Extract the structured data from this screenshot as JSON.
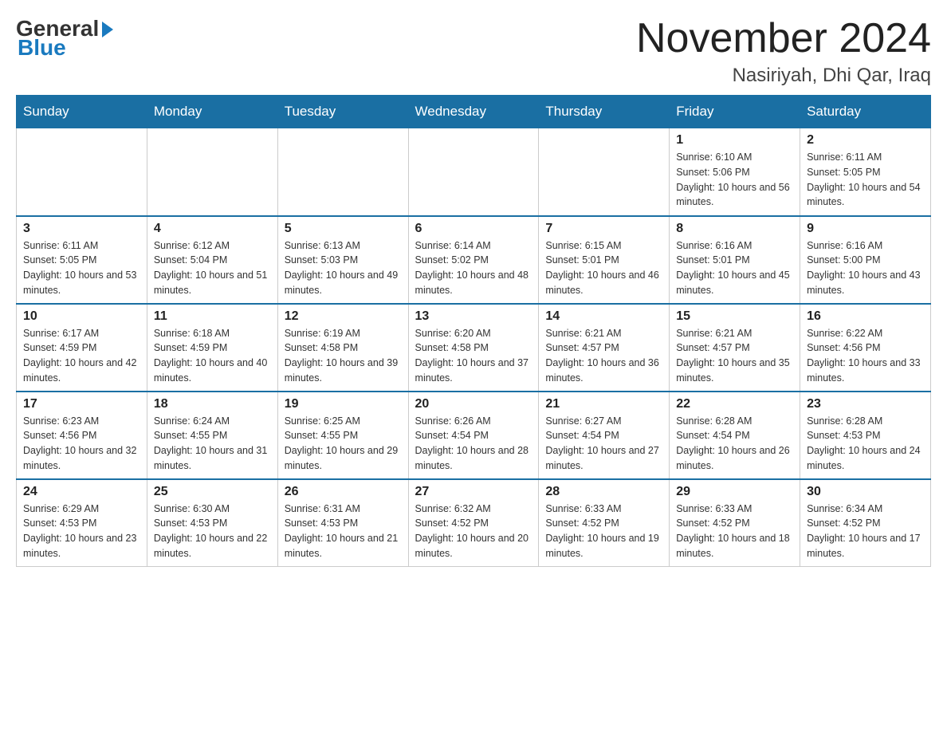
{
  "header": {
    "logo_general": "General",
    "logo_blue": "Blue",
    "month_title": "November 2024",
    "location": "Nasiriyah, Dhi Qar, Iraq"
  },
  "weekdays": [
    "Sunday",
    "Monday",
    "Tuesday",
    "Wednesday",
    "Thursday",
    "Friday",
    "Saturday"
  ],
  "weeks": [
    {
      "days": [
        {
          "number": "",
          "info": ""
        },
        {
          "number": "",
          "info": ""
        },
        {
          "number": "",
          "info": ""
        },
        {
          "number": "",
          "info": ""
        },
        {
          "number": "",
          "info": ""
        },
        {
          "number": "1",
          "info": "Sunrise: 6:10 AM\nSunset: 5:06 PM\nDaylight: 10 hours and 56 minutes."
        },
        {
          "number": "2",
          "info": "Sunrise: 6:11 AM\nSunset: 5:05 PM\nDaylight: 10 hours and 54 minutes."
        }
      ]
    },
    {
      "days": [
        {
          "number": "3",
          "info": "Sunrise: 6:11 AM\nSunset: 5:05 PM\nDaylight: 10 hours and 53 minutes."
        },
        {
          "number": "4",
          "info": "Sunrise: 6:12 AM\nSunset: 5:04 PM\nDaylight: 10 hours and 51 minutes."
        },
        {
          "number": "5",
          "info": "Sunrise: 6:13 AM\nSunset: 5:03 PM\nDaylight: 10 hours and 49 minutes."
        },
        {
          "number": "6",
          "info": "Sunrise: 6:14 AM\nSunset: 5:02 PM\nDaylight: 10 hours and 48 minutes."
        },
        {
          "number": "7",
          "info": "Sunrise: 6:15 AM\nSunset: 5:01 PM\nDaylight: 10 hours and 46 minutes."
        },
        {
          "number": "8",
          "info": "Sunrise: 6:16 AM\nSunset: 5:01 PM\nDaylight: 10 hours and 45 minutes."
        },
        {
          "number": "9",
          "info": "Sunrise: 6:16 AM\nSunset: 5:00 PM\nDaylight: 10 hours and 43 minutes."
        }
      ]
    },
    {
      "days": [
        {
          "number": "10",
          "info": "Sunrise: 6:17 AM\nSunset: 4:59 PM\nDaylight: 10 hours and 42 minutes."
        },
        {
          "number": "11",
          "info": "Sunrise: 6:18 AM\nSunset: 4:59 PM\nDaylight: 10 hours and 40 minutes."
        },
        {
          "number": "12",
          "info": "Sunrise: 6:19 AM\nSunset: 4:58 PM\nDaylight: 10 hours and 39 minutes."
        },
        {
          "number": "13",
          "info": "Sunrise: 6:20 AM\nSunset: 4:58 PM\nDaylight: 10 hours and 37 minutes."
        },
        {
          "number": "14",
          "info": "Sunrise: 6:21 AM\nSunset: 4:57 PM\nDaylight: 10 hours and 36 minutes."
        },
        {
          "number": "15",
          "info": "Sunrise: 6:21 AM\nSunset: 4:57 PM\nDaylight: 10 hours and 35 minutes."
        },
        {
          "number": "16",
          "info": "Sunrise: 6:22 AM\nSunset: 4:56 PM\nDaylight: 10 hours and 33 minutes."
        }
      ]
    },
    {
      "days": [
        {
          "number": "17",
          "info": "Sunrise: 6:23 AM\nSunset: 4:56 PM\nDaylight: 10 hours and 32 minutes."
        },
        {
          "number": "18",
          "info": "Sunrise: 6:24 AM\nSunset: 4:55 PM\nDaylight: 10 hours and 31 minutes."
        },
        {
          "number": "19",
          "info": "Sunrise: 6:25 AM\nSunset: 4:55 PM\nDaylight: 10 hours and 29 minutes."
        },
        {
          "number": "20",
          "info": "Sunrise: 6:26 AM\nSunset: 4:54 PM\nDaylight: 10 hours and 28 minutes."
        },
        {
          "number": "21",
          "info": "Sunrise: 6:27 AM\nSunset: 4:54 PM\nDaylight: 10 hours and 27 minutes."
        },
        {
          "number": "22",
          "info": "Sunrise: 6:28 AM\nSunset: 4:54 PM\nDaylight: 10 hours and 26 minutes."
        },
        {
          "number": "23",
          "info": "Sunrise: 6:28 AM\nSunset: 4:53 PM\nDaylight: 10 hours and 24 minutes."
        }
      ]
    },
    {
      "days": [
        {
          "number": "24",
          "info": "Sunrise: 6:29 AM\nSunset: 4:53 PM\nDaylight: 10 hours and 23 minutes."
        },
        {
          "number": "25",
          "info": "Sunrise: 6:30 AM\nSunset: 4:53 PM\nDaylight: 10 hours and 22 minutes."
        },
        {
          "number": "26",
          "info": "Sunrise: 6:31 AM\nSunset: 4:53 PM\nDaylight: 10 hours and 21 minutes."
        },
        {
          "number": "27",
          "info": "Sunrise: 6:32 AM\nSunset: 4:52 PM\nDaylight: 10 hours and 20 minutes."
        },
        {
          "number": "28",
          "info": "Sunrise: 6:33 AM\nSunset: 4:52 PM\nDaylight: 10 hours and 19 minutes."
        },
        {
          "number": "29",
          "info": "Sunrise: 6:33 AM\nSunset: 4:52 PM\nDaylight: 10 hours and 18 minutes."
        },
        {
          "number": "30",
          "info": "Sunrise: 6:34 AM\nSunset: 4:52 PM\nDaylight: 10 hours and 17 minutes."
        }
      ]
    }
  ]
}
